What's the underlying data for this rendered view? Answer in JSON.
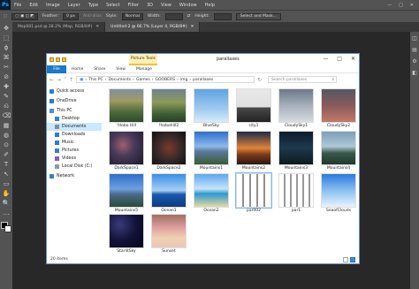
{
  "photoshop": {
    "logo": "Ps",
    "menu": [
      "File",
      "Edit",
      "Image",
      "Layer",
      "Type",
      "Select",
      "Filter",
      "3D",
      "View",
      "Window",
      "Help"
    ],
    "window_buttons": [
      "—",
      "□",
      "✕"
    ],
    "options": {
      "feather_label": "Feather:",
      "feather_value": "0 px",
      "anti_alias": "Anti-alias",
      "style_label": "Style:",
      "style_value": "Normal",
      "width_label": "Width:",
      "height_label": "Height:",
      "select_mask_button": "Select and Mask..."
    },
    "tabs": [
      {
        "label": "Map001.psd @ 28.2% (Map, RGB/8#)",
        "close": "✕",
        "active": false
      },
      {
        "label": "Untitled-2 @ 66.7% (Layer 4, RGB/8#)",
        "close": "✕",
        "active": true
      }
    ],
    "tools": [
      "✥",
      "⬚",
      "ϕ",
      "⌘",
      "✂",
      "⊘",
      "✚",
      "✎",
      "⎌",
      "⌫",
      "▦",
      "◍",
      "⊙",
      "✐",
      "T",
      "↖",
      "▭",
      "✋",
      "🔍",
      "…"
    ],
    "right_panel_icons": [
      "◫",
      "▤",
      "⚙",
      "◧"
    ]
  },
  "explorer": {
    "picture_tools_tab": "Picture Tools",
    "title": "parallaxes",
    "window_buttons": [
      "—",
      "□",
      "✕"
    ],
    "ribbon": {
      "file": "File",
      "tabs": [
        "Home",
        "Share",
        "View"
      ],
      "manage": "Manage"
    },
    "address": {
      "path": [
        "This PC",
        "Documents",
        "Games",
        "GOOBERS",
        "img",
        "parallaxes"
      ],
      "separator": "›"
    },
    "search_placeholder": "Search parallaxes",
    "nav": [
      {
        "label": "Quick access",
        "icon": "star-icon",
        "color": "#2b7cd3",
        "selected": false
      },
      {
        "label": "OneDrive",
        "icon": "cloud-icon",
        "color": "#2b7cd3",
        "selected": false
      },
      {
        "label": "This PC",
        "icon": "computer-icon",
        "color": "#4a8fd6",
        "selected": false
      },
      {
        "label": "Desktop",
        "icon": "desktop-icon",
        "color": "#3a7fc8",
        "selected": false
      },
      {
        "label": "Documents",
        "icon": "document-icon",
        "color": "#7a8ea6",
        "selected": true
      },
      {
        "label": "Downloads",
        "icon": "download-icon",
        "color": "#2b7cd3",
        "selected": false
      },
      {
        "label": "Music",
        "icon": "music-icon",
        "color": "#2b7cd3",
        "selected": false
      },
      {
        "label": "Pictures",
        "icon": "pictures-icon",
        "color": "#3a7fc8",
        "selected": false
      },
      {
        "label": "Videos",
        "icon": "video-icon",
        "color": "#7a5fc8",
        "selected": false
      },
      {
        "label": "Local Disk (C:)",
        "icon": "disk-icon",
        "color": "#8a9aaa",
        "selected": false
      },
      {
        "label": "Network",
        "icon": "network-icon",
        "color": "#3a7fc8",
        "selected": false
      }
    ],
    "files": [
      {
        "label": "!Hobo Hill",
        "bg": "linear-gradient(180deg,#7f8fa0 0%,#a09a60 35%,#4a6a3a 70%,#2e4a2a 100%)"
      },
      {
        "label": "!hobohill2",
        "bg": "linear-gradient(180deg,#6f8290 0%,#8c9a58 40%,#3e6036 75%,#2a3e26 100%)"
      },
      {
        "label": "BlueSky",
        "bg": "linear-gradient(180deg,#5ea4e0 0%,#9fcaf0 60%,#d7ecfb 100%)"
      },
      {
        "label": "city1",
        "bg": "linear-gradient(180deg,#e8e8e8 0%,#e0e0e0 55%,#4a4a4a 56%,#222 100%)"
      },
      {
        "label": "CloudySky1",
        "bg": "linear-gradient(180deg,#6c7888 0%,#a7b0bc 50%,#d8dbe0 100%)"
      },
      {
        "label": "CloudySky2",
        "bg": "linear-gradient(180deg,#545864 0%,#8a5a5a 50%,#c27a6a 100%)"
      },
      {
        "label": "DarkSpace1",
        "bg": "radial-gradient(circle at 40% 40%,#a06070 0%,#4a3a5a 40%,#1a1a2a 100%)"
      },
      {
        "label": "DarkSpace2",
        "bg": "radial-gradient(circle at 50% 50%,#7a3a2a 0%,#3a2a2a 50%,#111 100%)"
      },
      {
        "label": "Mountains1",
        "bg": "linear-gradient(180deg,#2f6fcf 0%,#8fb8e8 45%,#5a7a9a 60%,#3a5a3a 100%)"
      },
      {
        "label": "Mountains2",
        "bg": "linear-gradient(180deg,#1e2a4a 0%,#e0843a 50%,#7a3a1a 70%,#2a1a10 100%)"
      },
      {
        "label": "Mountains3",
        "bg": "linear-gradient(180deg,#0e1a2e 0%,#1e3a4e 50%,#0a1a1a 100%)"
      },
      {
        "label": "Mountains4",
        "bg": "linear-gradient(180deg,#7aa0b8 0%,#b0c8d8 45%,#3a5a4a 65%,#1e3a2e 100%)"
      },
      {
        "label": "Mountains5",
        "bg": "linear-gradient(180deg,#2e6ec8 0%,#6ea0e0 45%,#4a6a8a 62%,#2a4a3a 100%)"
      },
      {
        "label": "Ocean1",
        "bg": "linear-gradient(180deg,#3a8ee6 0%,#a8d0f4 50%,#1a5ab0 62%,#0e3a80 100%)"
      },
      {
        "label": "Ocean2",
        "bg": "linear-gradient(180deg,#5aa8f0 0%,#c8e4fa 45%,#2a9ad0 60%,#e8d8a0 100%)"
      },
      {
        "label": "par002",
        "bg": "repeating-linear-gradient(90deg,#fff 0px,#fff 6px,#222 7px,#fff 8px)"
      },
      {
        "label": "par1",
        "bg": "repeating-linear-gradient(90deg,#fff 0px,#fff 5px,#333 6px,#fff 7px)"
      },
      {
        "label": "SeaofClouds",
        "bg": "linear-gradient(180deg,#2a7ae0 0%,#8ac0f0 50%,#e8f2fc 100%)"
      },
      {
        "label": "StarlitSky",
        "bg": "radial-gradient(circle at 30% 30%,#3a3a7a 0%,#12123a 50%,#05051a 100%)"
      },
      {
        "label": "Sunset",
        "bg": "linear-gradient(180deg,#a07060 0%,#e0a0a0 40%,#f0d0b0 70%,#e8c8b8 100%)"
      }
    ],
    "status": {
      "count": "20 items"
    }
  }
}
